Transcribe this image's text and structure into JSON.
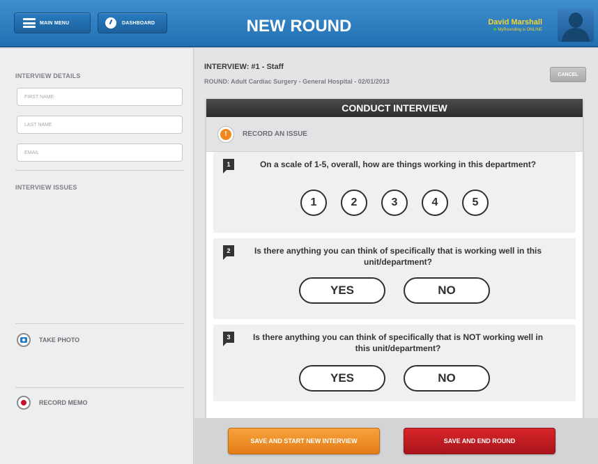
{
  "header": {
    "menu_label": "MAIN MENU",
    "dashboard_label": "DASHBOARD",
    "title": "NEW ROUND",
    "user_name": "David Marshall",
    "user_status": "MyRounding is ONLINE"
  },
  "sidebar": {
    "details_title": "INTERVIEW DETAILS",
    "first_name_placeholder": "FIRST NAME",
    "last_name_placeholder": "LAST NAME",
    "email_placeholder": "EMAIL",
    "issues_title": "INTERVIEW ISSUES",
    "take_photo_label": "TAKE PHOTO",
    "record_memo_label": "RECORD MEMO"
  },
  "main": {
    "interview_title": "INTERVIEW: #1 - Staff",
    "round_info": "ROUND: Adult Cardiac Surgery - General Hospital - 02/01/2013",
    "cancel_label": "CANCEL",
    "panel_title": "CONDUCT INTERVIEW",
    "record_issue_label": "RECORD AN ISSUE",
    "questions": [
      {
        "number": "1",
        "text": "On a scale of 1-5, overall, how are things working in this department?",
        "options": [
          "1",
          "2",
          "3",
          "4",
          "5"
        ]
      },
      {
        "number": "2",
        "text": "Is there anything you can think of specifically that is working well in this unit/department?",
        "options": [
          "YES",
          "NO"
        ]
      },
      {
        "number": "3",
        "text": "Is there anything you can think of specifically that is NOT working well in this unit/department?",
        "options": [
          "YES",
          "NO"
        ]
      }
    ]
  },
  "footer": {
    "save_new_label": "SAVE AND START NEW INTERVIEW",
    "save_end_label": "SAVE AND END ROUND"
  },
  "colors": {
    "header_blue": "#2170b3",
    "user_name_yellow": "#f2d531",
    "orange_button": "#e47c15",
    "red_button": "#a9141a"
  },
  "icons": [
    "menu-icon",
    "dashboard-icon",
    "avatar-icon",
    "camera-icon",
    "record-icon",
    "alert-icon"
  ]
}
